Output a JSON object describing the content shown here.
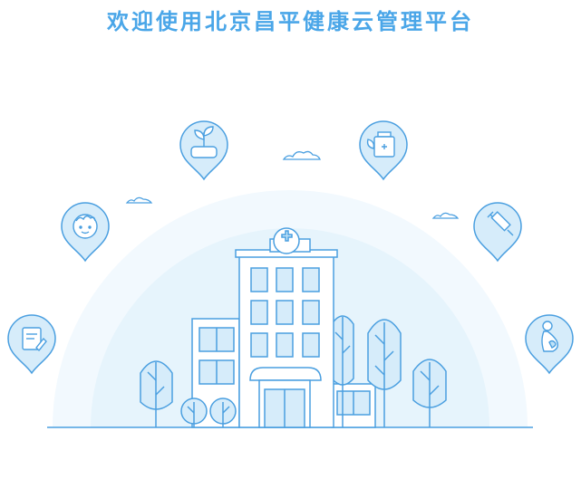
{
  "header": {
    "title": "欢迎使用北京昌平健康云管理平台"
  },
  "colors": {
    "accent": "#4aa6e8",
    "line": "#4a9fe0",
    "fill_light": "#d6ecfa",
    "fill_mid": "#bfe2f7",
    "bg_arc": "#eef7fd"
  },
  "pins": [
    {
      "name": "sprout-pin",
      "icon": "sprout-icon"
    },
    {
      "name": "medicine-pin",
      "icon": "medicine-bottle-icon"
    },
    {
      "name": "baby-pin",
      "icon": "baby-face-icon"
    },
    {
      "name": "vaccine-pin",
      "icon": "syringe-icon"
    },
    {
      "name": "record-pin",
      "icon": "medical-record-icon"
    },
    {
      "name": "maternity-pin",
      "icon": "pregnant-woman-icon"
    }
  ]
}
